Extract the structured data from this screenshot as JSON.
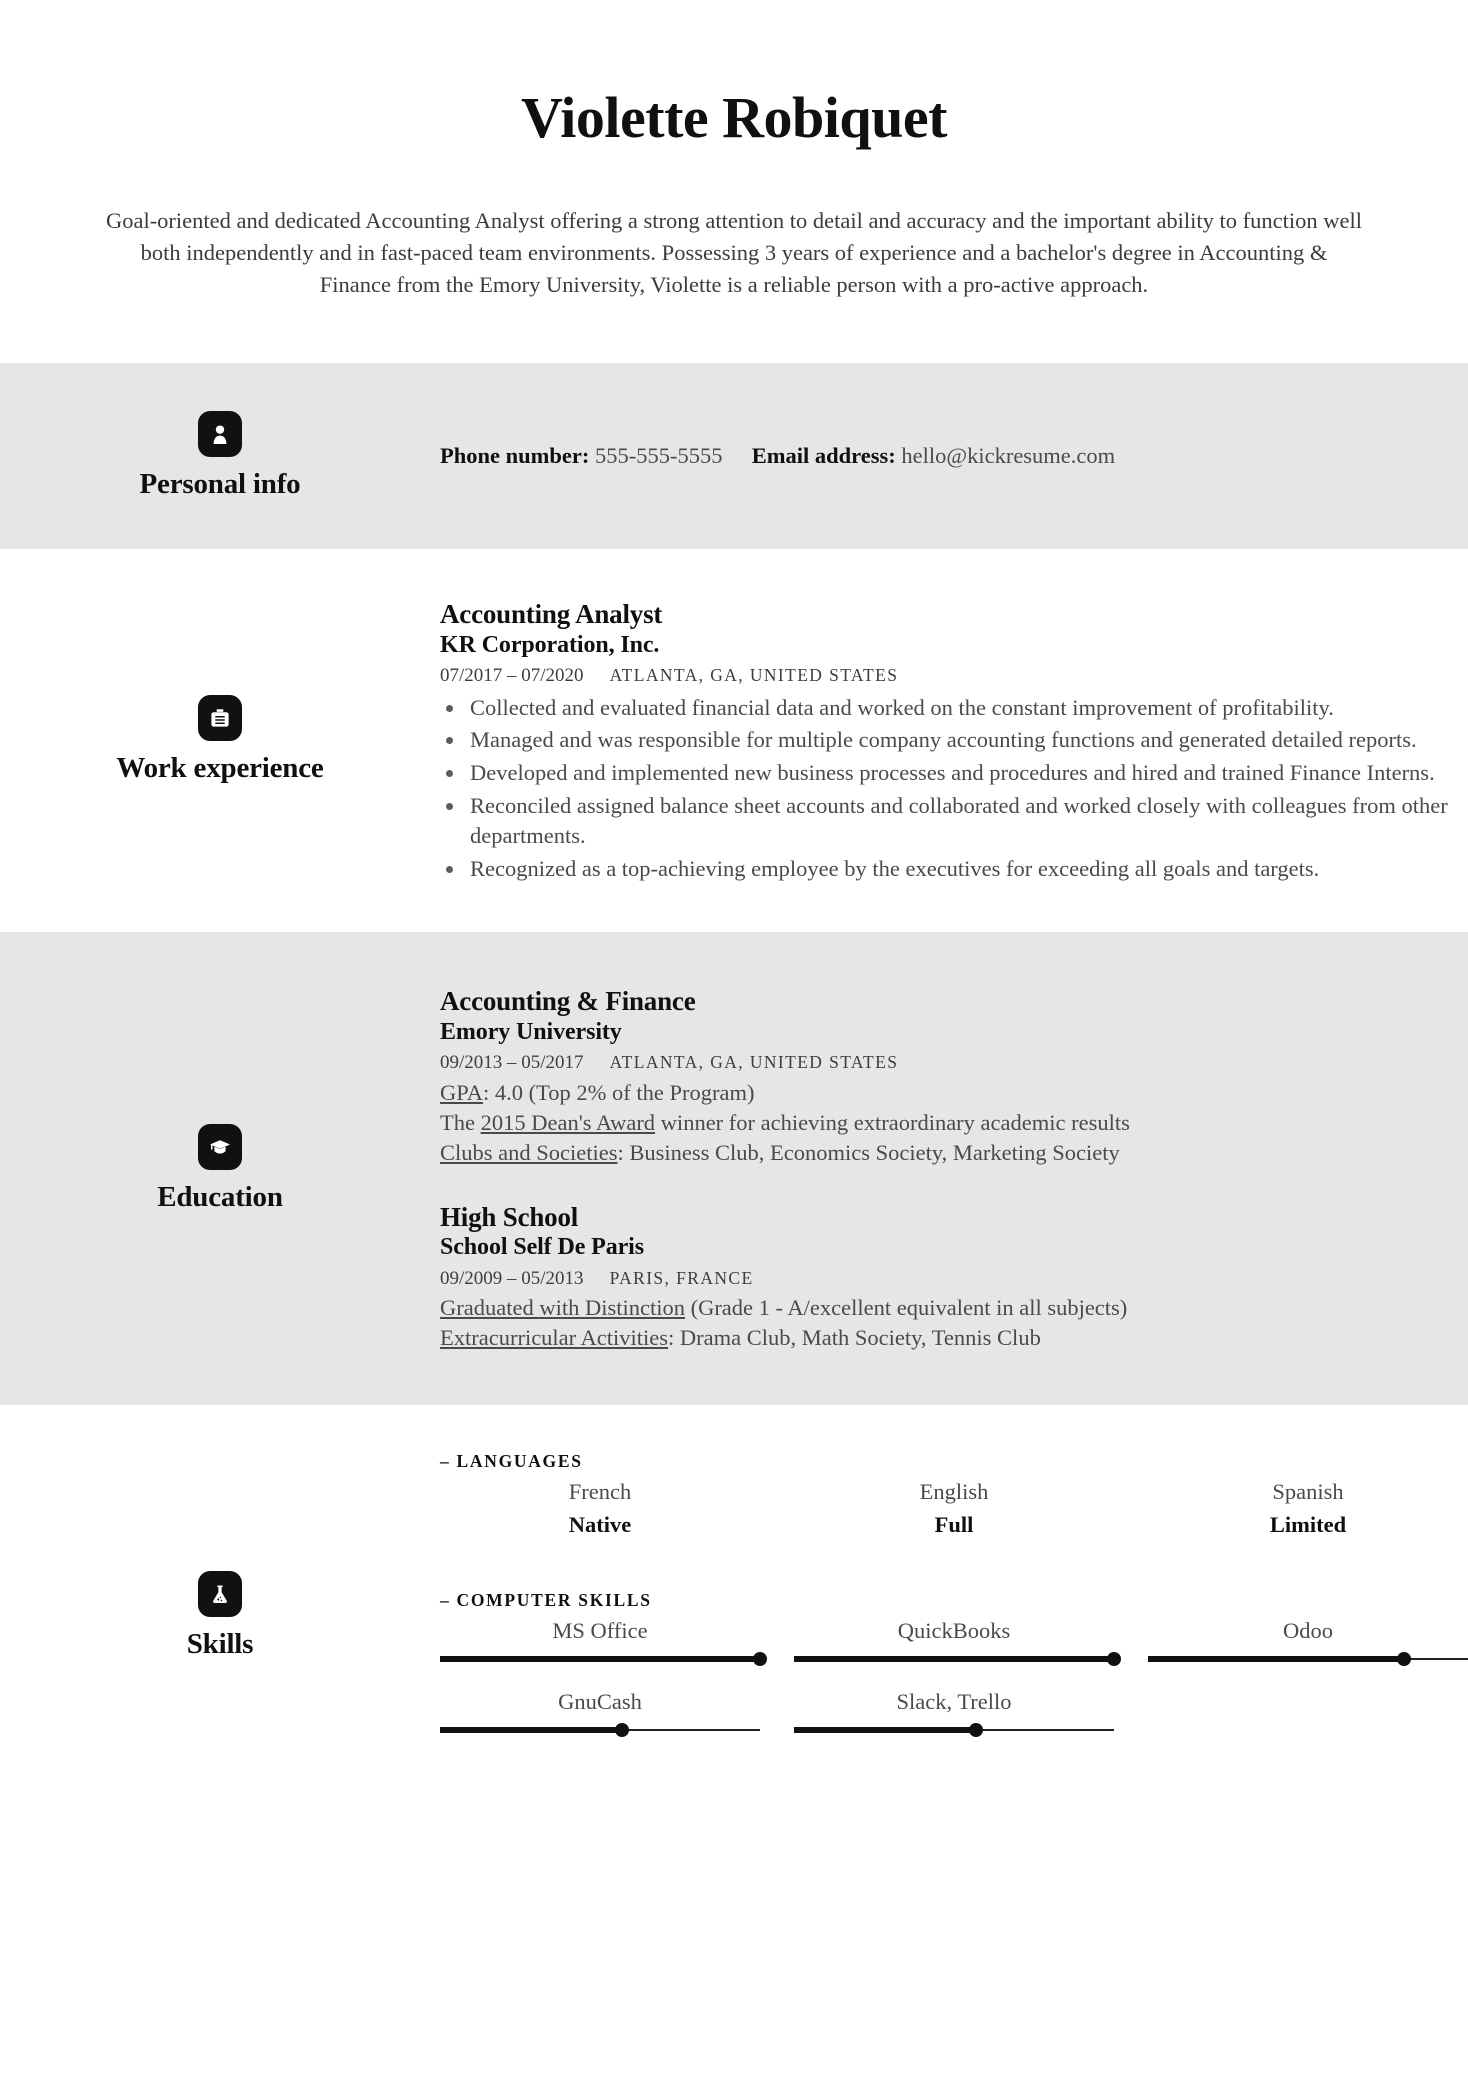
{
  "header": {
    "name": "Violette Robiquet",
    "summary": "Goal-oriented and dedicated Accounting Analyst offering a strong attention to detail and accuracy and the important ability to function well both independently and in fast-paced team environments. Possessing 3 years of experience and a bachelor's degree in Accounting & Finance from the Emory University, Violette is a reliable person with a pro-active approach."
  },
  "personal_info": {
    "section_title": "Personal info",
    "icon": "person-icon",
    "phone_label": "Phone number:",
    "phone_value": "555-555-5555",
    "email_label": "Email address:",
    "email_value": "hello@kickresume.com"
  },
  "work_experience": {
    "section_title": "Work experience",
    "icon": "briefcase-icon",
    "entries": [
      {
        "title": "Accounting Analyst",
        "company": "KR Corporation, Inc.",
        "dates": "07/2017 – 07/2020",
        "location": "ATLANTA, GA, UNITED STATES",
        "bullets": [
          "Collected and evaluated financial data and worked on the constant improvement of profitability.",
          "Managed and was responsible for multiple company accounting functions and generated detailed reports.",
          "Developed and implemented new business processes and procedures and hired and trained Finance Interns.",
          "Reconciled assigned balance sheet accounts and collaborated and worked closely with colleagues from other departments.",
          "Recognized as a top-achieving employee by the executives for exceeding all goals and targets."
        ]
      }
    ]
  },
  "education": {
    "section_title": "Education",
    "icon": "graduation-cap-icon",
    "entries": [
      {
        "title": "Accounting & Finance",
        "school": "Emory University",
        "dates": "09/2013 – 05/2017",
        "location": "ATLANTA, GA, UNITED STATES",
        "lines": [
          {
            "underlined": "GPA",
            "rest": ": 4.0 (Top 2% of the Program)"
          },
          {
            "prefix": "The ",
            "underlined": "2015 Dean's Award",
            "rest": " winner for achieving extraordinary academic results"
          },
          {
            "underlined": "Clubs and Societies",
            "rest": ": Business Club, Economics Society, Marketing Society"
          }
        ]
      },
      {
        "title": "High School",
        "school": "School Self De Paris",
        "dates": "09/2009 – 05/2013",
        "location": "PARIS, FRANCE",
        "lines": [
          {
            "underlined": "Graduated with Distinction",
            "rest": " (Grade 1 - A/excellent equivalent in all subjects)"
          },
          {
            "underlined": "Extracurricular Activities",
            "rest": ": Drama Club, Math Society, Tennis Club"
          }
        ]
      }
    ]
  },
  "skills": {
    "section_title": "Skills",
    "icon": "flask-icon",
    "groups": [
      {
        "title": "– LANGUAGES",
        "type": "level",
        "items": [
          {
            "name": "French",
            "level": "Native"
          },
          {
            "name": "English",
            "level": "Full"
          },
          {
            "name": "Spanish",
            "level": "Limited"
          }
        ]
      },
      {
        "title": "– COMPUTER SKILLS",
        "type": "bar",
        "items": [
          {
            "name": "MS Office",
            "percent": 100
          },
          {
            "name": "QuickBooks",
            "percent": 100
          },
          {
            "name": "Odoo",
            "percent": 80
          },
          {
            "name": "GnuCash",
            "percent": 57
          },
          {
            "name": "Slack, Trello",
            "percent": 57
          }
        ]
      }
    ]
  },
  "colors": {
    "band_shaded": "#e6e6e6",
    "band_plain": "#ffffff",
    "ink": "#101010",
    "body_text": "#4a4a4a",
    "icon_bg": "#111111"
  }
}
